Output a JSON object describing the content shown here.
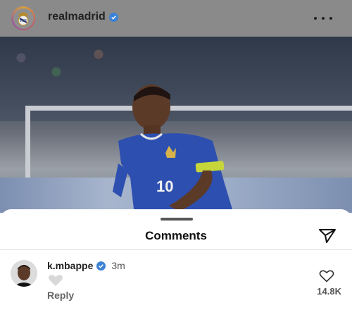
{
  "post": {
    "username": "realmadrid",
    "verified": true
  },
  "comments_sheet": {
    "title": "Comments",
    "comment": {
      "username": "k.mbappe",
      "verified": true,
      "time": "3m",
      "reaction_icon": "heart-icon",
      "reply_label": "Reply",
      "like_count": "14.8K"
    }
  },
  "icons": {
    "more": "more-horizontal-icon",
    "share": "send-icon",
    "like": "heart-outline-icon"
  },
  "colors": {
    "verified_blue": "#3b82d6",
    "header_gray": "#8a8a8a"
  }
}
